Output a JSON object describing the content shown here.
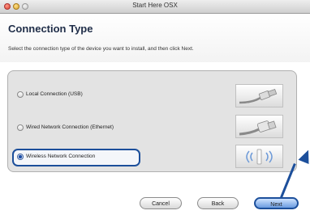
{
  "window": {
    "title": "Start Here OSX"
  },
  "header": {
    "title": "Connection Type",
    "instruction": "Select the connection type of the device you want to install, and then click Next."
  },
  "options": [
    {
      "label": "Local Connection (USB)",
      "selected": false,
      "image_icon": "usb-cable-icon"
    },
    {
      "label": "Wired Network Connection (Ethernet)",
      "selected": false,
      "image_icon": "ethernet-cable-icon"
    },
    {
      "label": "Wireless Network Connection",
      "selected": true,
      "image_icon": "wireless-access-point-icon"
    }
  ],
  "buttons": {
    "cancel": "Cancel",
    "back": "Back",
    "next": "Next"
  },
  "colors": {
    "highlight": "#1c4f9b",
    "title_text": "#1f2d48"
  }
}
